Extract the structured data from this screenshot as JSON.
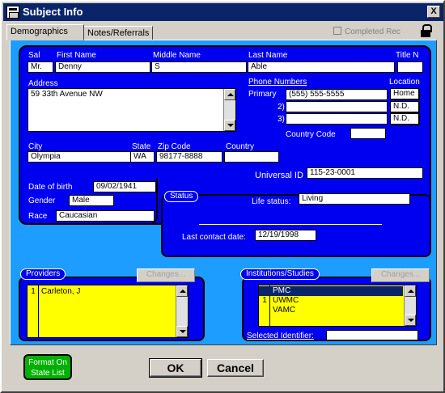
{
  "window": {
    "title": "Subject Info",
    "close_glyph": "X"
  },
  "tabs": [
    {
      "label": "Demographics"
    },
    {
      "label": "Notes/Referrals"
    }
  ],
  "completed_rec": "Completed Rec",
  "labels": {
    "sal": "Sal",
    "first_name": "First Name",
    "middle_name": "Middle Name",
    "last_name": "Last Name",
    "title": "Title N",
    "address": "Address",
    "phone_numbers": "Phone Numbers",
    "location": "Location",
    "primary": "Primary",
    "phone2": "2)",
    "phone3": "3)",
    "country_code": "Country Code",
    "city": "City",
    "state": "State",
    "zip": "Zip Code",
    "country": "Country",
    "universal_id": "Universal ID",
    "dob": "Date of birth",
    "gender": "Gender",
    "race": "Race",
    "status": "Status",
    "life_status": "Life status:",
    "last_contact": "Last contact date:",
    "providers": "Providers",
    "institutions": "Institutions/Studies",
    "selected_identifier": "Selected Identifier:"
  },
  "subject": {
    "sal": "Mr.",
    "first_name": "Denny",
    "middle_name": "S",
    "last_name": "Able",
    "title": "",
    "address": "59 33th Avenue NW",
    "phones": [
      {
        "number": "(555) 555-5555",
        "location": "Home"
      },
      {
        "number": "",
        "location": "N.D."
      },
      {
        "number": "",
        "location": "N.D."
      }
    ],
    "country_code": "",
    "city": "Olympia",
    "state": "WA",
    "zip": "98177-8888",
    "country": "",
    "universal_id": "115-23-0001",
    "dob": "09/02/1941",
    "gender": "Male",
    "race": "Caucasian",
    "life_status": "Living",
    "last_contact": "12/19/1998",
    "selected_identifier": ""
  },
  "providers": {
    "changes_label": "Changes...",
    "rows": [
      {
        "n": "1",
        "name": "Carleton, J"
      }
    ]
  },
  "institutions": {
    "changes_label": "Changes...",
    "rows": [
      {
        "n": "",
        "name": "PMC"
      },
      {
        "n": "1",
        "name": "UWMC"
      },
      {
        "n": "",
        "name": "VAMC"
      }
    ]
  },
  "buttons": {
    "format_line1": "Format On",
    "format_line2": "State List",
    "ok": "OK",
    "cancel": "Cancel"
  },
  "colors": {
    "panel": "#0000f0",
    "background": "#1c9dff",
    "list": "#ffff00",
    "format_button": "#00b000",
    "titlebar": "#0a246a"
  }
}
